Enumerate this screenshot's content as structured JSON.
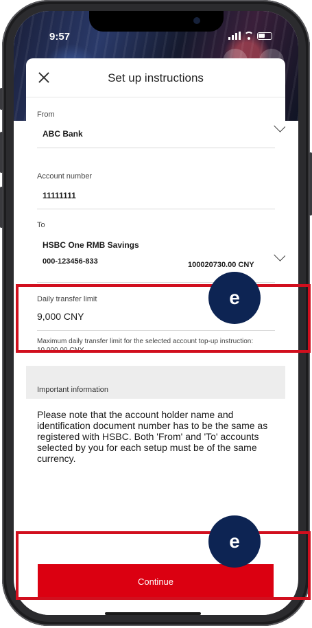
{
  "status_bar": {
    "time": "9:57"
  },
  "sheet": {
    "title": "Set up instructions"
  },
  "from": {
    "label": "From",
    "value": "ABC Bank"
  },
  "account_number": {
    "label": "Account number",
    "value": "11111111"
  },
  "to": {
    "label": "To",
    "account_name": "HSBC  One RMB Savings",
    "account_id": "000-123456-833",
    "balance": "100020730.00 CNY"
  },
  "daily_limit": {
    "label": "Daily transfer limit",
    "value": "9,000 CNY",
    "helper": "Maximum daily transfer limit for the selected account top-up instruction: 10,000.00 CNY"
  },
  "important": {
    "title": "Important information",
    "text": "Please note that the account holder name and identification document number has to be the same as registered with HSBC. Both 'From' and 'To' accounts selected by you for each setup must be of the same currency."
  },
  "continue_label": "Continue",
  "annotations": {
    "badge_1": "e",
    "badge_2": "e",
    "color": "#d10f1e",
    "badge_color": "#0d2453"
  },
  "colors": {
    "brand_red": "#db0011"
  }
}
